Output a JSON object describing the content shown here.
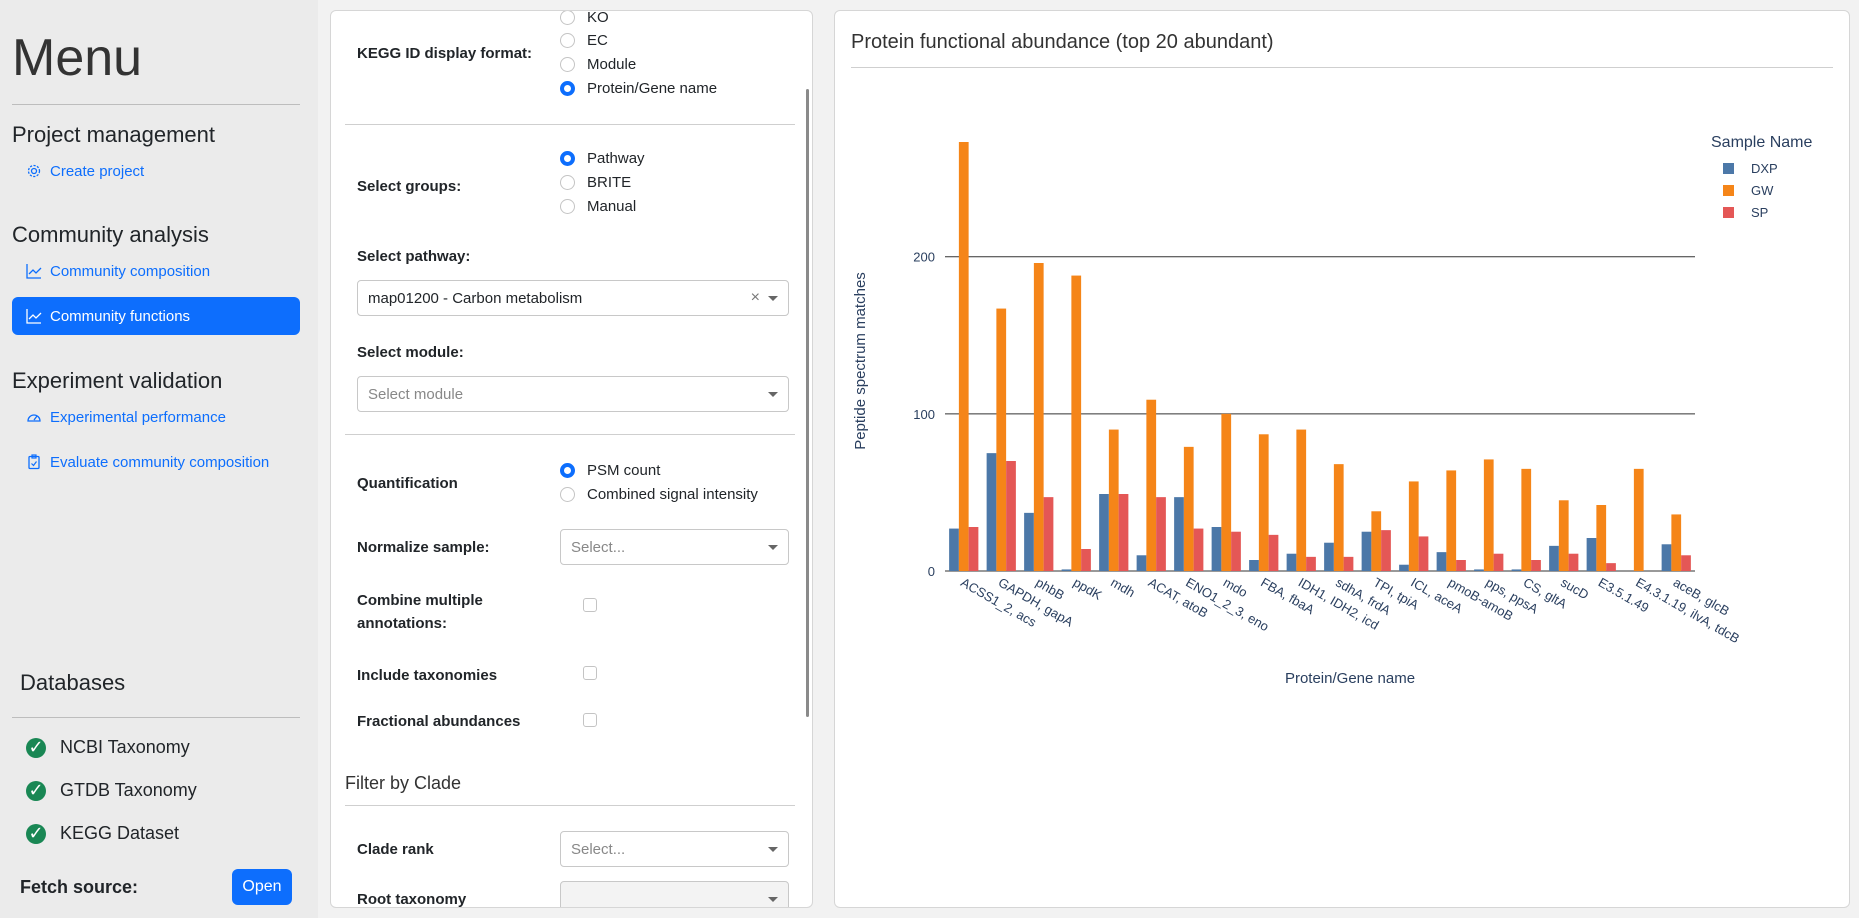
{
  "sidebar": {
    "menu_title": "Menu",
    "sections": {
      "project": "Project management",
      "community": "Community analysis",
      "experiment": "Experiment validation"
    },
    "items": {
      "create_project": "Create project",
      "community_composition": "Community composition",
      "community_functions": "Community functions",
      "experimental_performance": "Experimental performance",
      "evaluate_composition": "Evaluate community composition"
    },
    "databases_title": "Databases",
    "databases": [
      "NCBI Taxonomy",
      "GTDB Taxonomy",
      "KEGG Dataset"
    ],
    "fetch_label": "Fetch source:",
    "open_button": "Open"
  },
  "form": {
    "kegg_label": "KEGG ID display format:",
    "kegg_options": [
      "KO",
      "EC",
      "Module",
      "Protein/Gene name"
    ],
    "kegg_selected": "Protein/Gene name",
    "groups_label": "Select groups:",
    "groups_options": [
      "Pathway",
      "BRITE",
      "Manual"
    ],
    "groups_selected": "Pathway",
    "pathway_label": "Select pathway:",
    "pathway_value": "map01200 - Carbon metabolism",
    "module_label": "Select module:",
    "module_placeholder": "Select module",
    "quant_label": "Quantification",
    "quant_options": [
      "PSM count",
      "Combined signal intensity"
    ],
    "quant_selected": "PSM count",
    "normalize_label": "Normalize sample:",
    "normalize_placeholder": "Select...",
    "combine_label": "Combine multiple annotations:",
    "include_tax_label": "Include taxonomies",
    "fractional_label": "Fractional abundances",
    "clade_title": "Filter by Clade",
    "clade_rank_label": "Clade rank",
    "clade_rank_placeholder": "Select...",
    "root_tax_label": "Root taxonomy"
  },
  "chart_panel_title": "Protein functional abundance (top 20 abundant)",
  "chart_data": {
    "type": "bar",
    "xlabel": "Protein/Gene name",
    "ylabel": "Peptide spectrum matches",
    "ylim": [
      0,
      280
    ],
    "yticks": [
      0,
      100,
      200
    ],
    "legend_title": "Sample Name",
    "legend_position": "top-right",
    "categories": [
      "ACSS1_2, acs",
      "GAPDH, gapA",
      "phbB",
      "ppdK",
      "mdh",
      "ACAT, atoB",
      "ENO1_2_3, eno",
      "mdo",
      "FBA, fbaA",
      "IDH1, IDH2, icd",
      "sdhA, frdA",
      "TPI, tpiA",
      "ICL, aceA",
      "pmoB-amoB",
      "pps, ppsA",
      "CS, gltA",
      "sucD",
      "E3.5.1.49",
      "E4.3.1.19, ilvA, tdcB",
      "aceB, glcB"
    ],
    "series": [
      {
        "name": "DXP",
        "color": "#4c78a8",
        "values": [
          27,
          75,
          37,
          1,
          49,
          10,
          47,
          28,
          7,
          11,
          18,
          25,
          4,
          12,
          1,
          1,
          16,
          21,
          0,
          17
        ]
      },
      {
        "name": "GW",
        "color": "#f58518",
        "values": [
          273,
          167,
          196,
          188,
          90,
          109,
          79,
          100,
          87,
          90,
          68,
          38,
          57,
          64,
          71,
          65,
          45,
          42,
          65,
          36
        ]
      },
      {
        "name": "SP",
        "color": "#e45756",
        "values": [
          28,
          70,
          47,
          14,
          49,
          47,
          27,
          25,
          23,
          9,
          9,
          26,
          22,
          7,
          11,
          7,
          11,
          5,
          0,
          10
        ]
      }
    ]
  }
}
